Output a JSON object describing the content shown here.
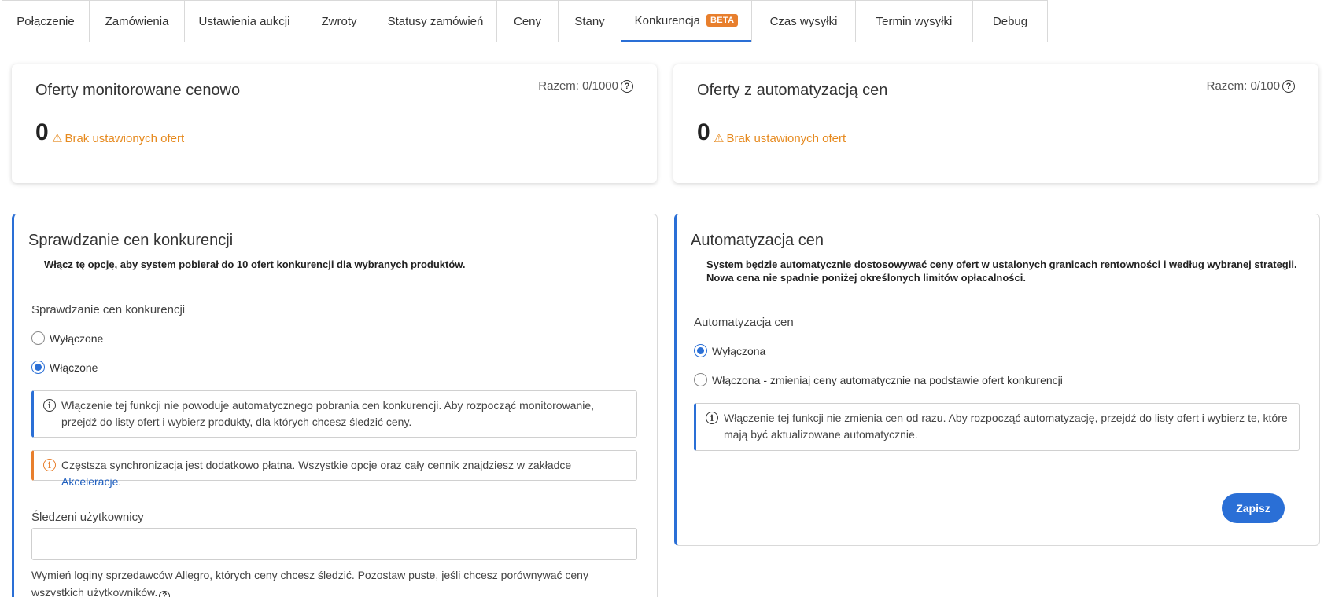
{
  "tabs": [
    {
      "label": "Połączenie",
      "active": false
    },
    {
      "label": "Zamówienia",
      "active": false
    },
    {
      "label": "Ustawienia aukcji",
      "active": false
    },
    {
      "label": "Zwroty",
      "active": false
    },
    {
      "label": "Statusy zamówień",
      "active": false
    },
    {
      "label": "Ceny",
      "active": false
    },
    {
      "label": "Stany",
      "active": false
    },
    {
      "label": "Konkurencja",
      "active": true,
      "badge": "BETA"
    },
    {
      "label": "Czas wysyłki",
      "active": false
    },
    {
      "label": "Termin wysyłki",
      "active": false
    },
    {
      "label": "Debug",
      "active": false
    }
  ],
  "summary": {
    "monitored": {
      "title": "Oferty monitorowane cenowo",
      "total": "Razem: 0/1000",
      "count": "0",
      "warning": "Brak ustawionych ofert"
    },
    "automated": {
      "title": "Oferty z automatyzacją cen",
      "total": "Razem: 0/100",
      "count": "0",
      "warning": "Brak ustawionych ofert"
    }
  },
  "competition": {
    "title": "Sprawdzanie cen konkurencji",
    "description": "Włącz tę opcję, aby system pobierał do 10 ofert konkurencji dla wybranych produktów.",
    "field_label": "Sprawdzanie cen konkurencji",
    "options": [
      {
        "label": "Wyłączone",
        "checked": false
      },
      {
        "label": "Włączone",
        "checked": true
      }
    ],
    "info": "Włączenie tej funkcji nie powoduje automatycznego pobrania cen konkurencji. Aby rozpocząć monitorowanie, przejdź do listy ofert i wybierz produkty, dla których chcesz śledzić ceny.",
    "sync_note": "Częstsza synchronizacja jest dodatkowo płatna. Wszystkie opcje oraz cały cennik znajdziesz w zakładce ",
    "sync_link": "Akceleracje",
    "sync_end": ".",
    "tracked_label": "Śledzeni użytkownicy",
    "tracked_value": "",
    "tracked_help": "Wymień loginy sprzedawców Allegro, których ceny chcesz śledzić. Pozostaw puste, jeśli chcesz porównywać ceny wszystkich użytkowników."
  },
  "automation": {
    "title": "Automatyzacja cen",
    "description_line1": "System będzie automatycznie dostosowywać ceny ofert w ustalonych granicach rentowności i według wybranej strategii.",
    "description_line2": "Nowa cena nie spadnie poniżej określonych limitów opłacalności.",
    "field_label": "Automatyzacja cen",
    "options": [
      {
        "label": "Wyłączona",
        "checked": true
      },
      {
        "label": "Włączona - zmieniaj ceny automatycznie na podstawie ofert konkurencji",
        "checked": false
      }
    ],
    "info": "Włączenie tej funkcji nie zmienia cen od razu. Aby rozpocząć automatyzację, przejdź do listy ofert i wybierz te, które mają być aktualizowane automatycznie.",
    "save_label": "Zapisz"
  },
  "colors": {
    "accent": "#2a6fd6",
    "warning": "#e68a1f",
    "badge": "#e87f2d"
  }
}
